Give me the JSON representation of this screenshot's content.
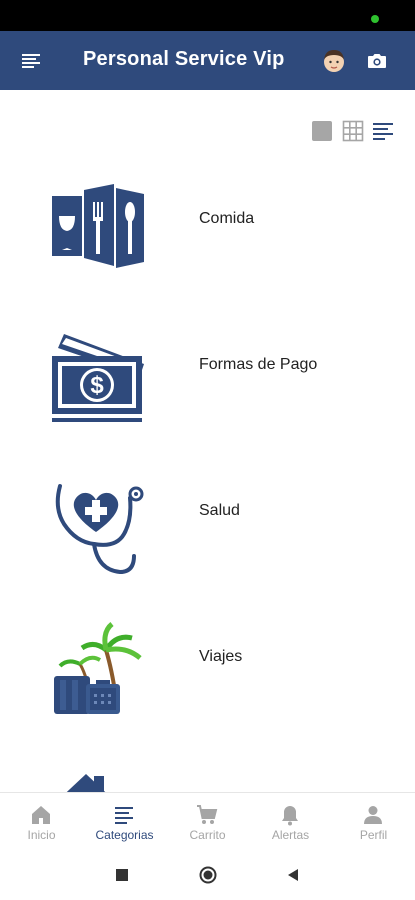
{
  "app_bar": {
    "title": "Personal Service Vip"
  },
  "view_toggle": {
    "options": [
      "single-view",
      "grid-view",
      "list-view"
    ],
    "selected": "list-view"
  },
  "categories": [
    {
      "label": "Comida",
      "icon": "food-menu-icon"
    },
    {
      "label": "Formas de Pago",
      "icon": "money-icon"
    },
    {
      "label": "Salud",
      "icon": "health-icon"
    },
    {
      "label": "Viajes",
      "icon": "travel-icon"
    }
  ],
  "bottom_nav": {
    "active": "Categorias",
    "items": [
      {
        "label": "Inicio",
        "icon": "home-icon"
      },
      {
        "label": "Categorias",
        "icon": "list-icon"
      },
      {
        "label": "Carrito",
        "icon": "cart-icon"
      },
      {
        "label": "Alertas",
        "icon": "bell-icon"
      },
      {
        "label": "Perfil",
        "icon": "person-icon"
      }
    ]
  },
  "colors": {
    "primary": "#2f4a7c",
    "inactive": "#a5a5a5",
    "icon_navy": "#2f4a7c"
  }
}
